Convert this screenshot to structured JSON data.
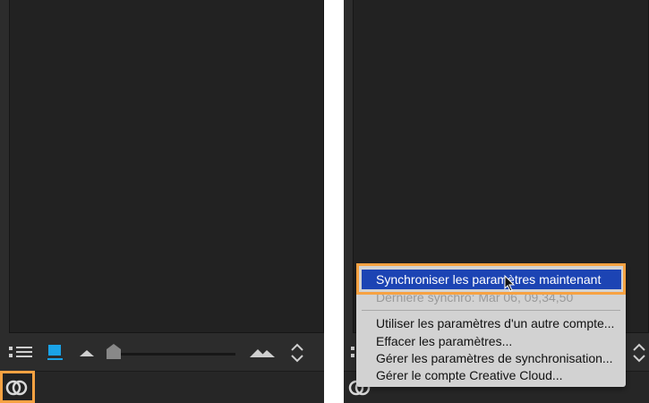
{
  "sync_menu": {
    "sync_now": "Synchroniser les paramètres maintenant",
    "last_sync": "Dernière synchro: Mar 06, 09,34,50",
    "use_other_account": "Utiliser les paramètres d'un autre compte...",
    "clear_settings": "Effacer les paramètres...",
    "manage_sync": "Gérer les paramètres de synchronisation...",
    "manage_cc": "Gérer le compte Creative Cloud..."
  },
  "toolbar": {
    "thumbnail_size_slider": 0.0,
    "icons": [
      "view-mode-icon",
      "list-view-icon",
      "single-image-icon",
      "small-mountain-icon",
      "slider-handle-icon",
      "large-mountains-icon",
      "sort-arrows-icon"
    ]
  },
  "colors": {
    "highlight": "#f7a242",
    "menu_selected": "#1c44b4",
    "active_icon": "#1aa3e8"
  }
}
